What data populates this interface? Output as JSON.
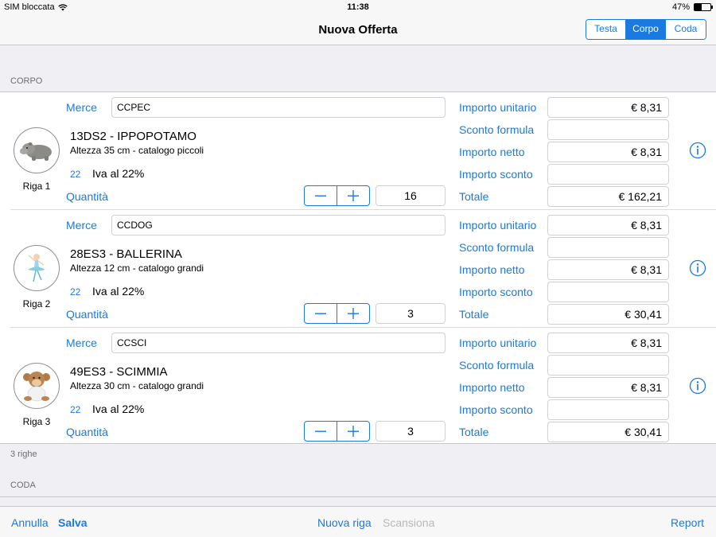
{
  "status_bar": {
    "carrier": "SIM bloccata",
    "time": "11:38",
    "battery": "47%",
    "battery_level": 0.47
  },
  "nav": {
    "title": "Nuova Offerta",
    "segments": [
      {
        "label": "Testa",
        "active": false
      },
      {
        "label": "Corpo",
        "active": true
      },
      {
        "label": "Coda",
        "active": false
      }
    ]
  },
  "sections": {
    "corpo": "CORPO",
    "coda": "CODA",
    "count": "3 righe"
  },
  "labels": {
    "merce": "Merce",
    "quantita": "Quantità",
    "importo_unitario": "Importo unitario",
    "sconto_formula": "Sconto formula",
    "importo_netto": "Importo netto",
    "importo_sconto": "Importo sconto",
    "totale": "Totale"
  },
  "rows": [
    {
      "riga": "Riga 1",
      "merce": "CCPEC",
      "title": "13DS2 - IPPOPOTAMO",
      "desc": "Altezza 35 cm - catalogo piccoli",
      "iva_code": "22",
      "iva_text": "Iva al 22%",
      "quantity": "16",
      "importo_unitario": "€ 8,31",
      "sconto_formula": "",
      "importo_netto": "€ 8,31",
      "importo_sconto": "",
      "totale": "€ 162,21",
      "image": "hippo-plush"
    },
    {
      "riga": "Riga 2",
      "merce": "CCDOG",
      "title": "28ES3 - BALLERINA",
      "desc": "Altezza 12 cm - catalogo grandi",
      "iva_code": "22",
      "iva_text": "Iva al 22%",
      "quantity": "3",
      "importo_unitario": "€ 8,31",
      "sconto_formula": "",
      "importo_netto": "€ 8,31",
      "importo_sconto": "",
      "totale": "€ 30,41",
      "image": "ballerina-figure"
    },
    {
      "riga": "Riga 3",
      "merce": "CCSCI",
      "title": "49ES3 - SCIMMIA",
      "desc": "Altezza 30 cm - catalogo grandi",
      "iva_code": "22",
      "iva_text": "Iva al 22%",
      "quantity": "3",
      "importo_unitario": "€ 8,31",
      "sconto_formula": "",
      "importo_netto": "€ 8,31",
      "importo_sconto": "",
      "totale": "€ 30,41",
      "image": "monkey-plush"
    }
  ],
  "toolbar": {
    "annulla": "Annulla",
    "salva": "Salva",
    "nuova_riga": "Nuova riga",
    "scansiona": "Scansiona",
    "report": "Report"
  },
  "colors": {
    "accent": "#1a7ae0",
    "background": "#efeff4",
    "disabled": "#b8b8bd"
  }
}
